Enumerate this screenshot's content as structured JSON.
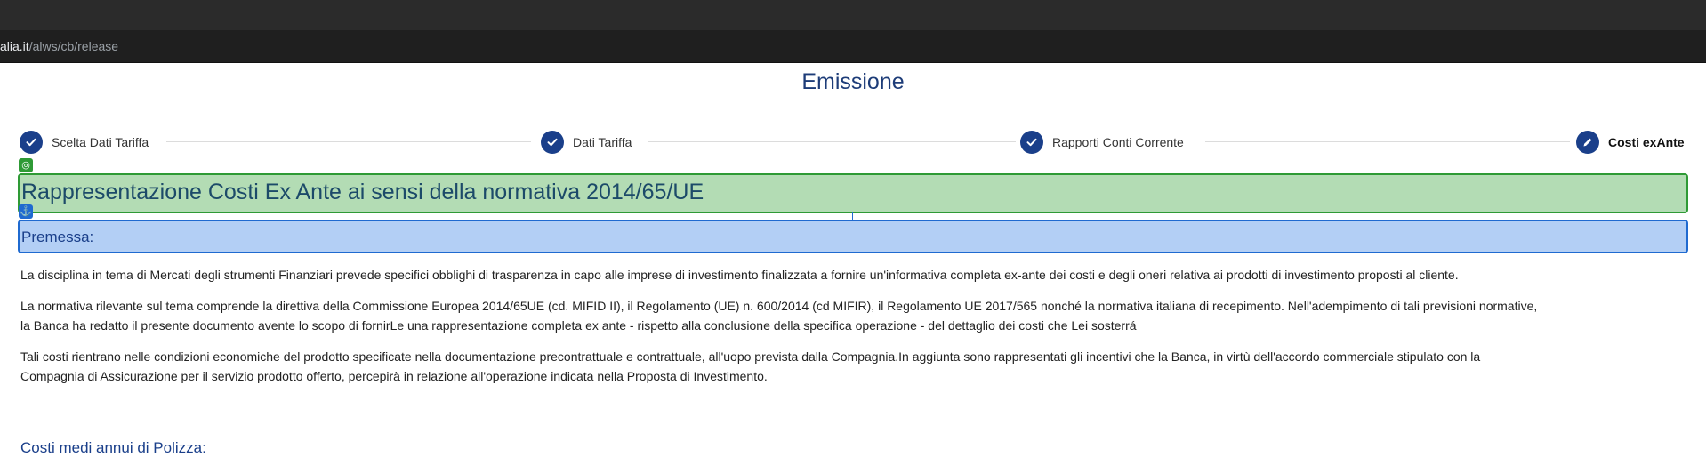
{
  "browser": {
    "url_host": "alia.it",
    "url_path": "/alws/cb/release"
  },
  "page": {
    "title": "Emissione"
  },
  "stepper": {
    "steps": [
      {
        "label": "Scelta Dati Tariffa",
        "state": "completed",
        "icon": "check-icon"
      },
      {
        "label": "Dati Tariffa",
        "state": "completed",
        "icon": "check-icon"
      },
      {
        "label": "Rapporti Conti Corrente",
        "state": "completed",
        "icon": "check-icon"
      },
      {
        "label": "Costi exAnte",
        "state": "active",
        "icon": "pencil-icon"
      }
    ]
  },
  "sections": {
    "main_title": "Rappresentazione Costi Ex Ante ai sensi della normativa 2014/65/UE",
    "premessa_title": "Premessa:"
  },
  "paragraphs": {
    "p1": "La disciplina in tema di Mercati degli strumenti Finanziari prevede specifici obblighi di trasparenza in capo alle imprese di investimento finalizzata a fornire un'informativa completa ex-ante dei costi e degli oneri relativa ai prodotti di investimento proposti al cliente.",
    "p2_line1": "La normativa rilevante sul tema comprende la direttiva della Commissione Europea 2014/65UE (cd. MIFID II), il Regolamento (UE) n. 600/2014 (cd MIFIR), il Regolamento UE 2017/565 nonché la normativa italiana di recepimento. Nell'adempimento di tali previsioni normative,",
    "p2_line2": "la Banca ha redatto il presente documento avente lo scopo di fornirLe una rappresentazione completa ex ante - rispetto alla conclusione della specifica operazione - del dettaglio dei costi che Lei sosterrá",
    "p3_line1": "Tali costi rientrano nelle condizioni economiche del prodotto specificate nella documentazione precontrattuale e contrattuale, all'uopo prevista dalla Compagnia.In aggiunta sono rappresentati gli incentivi che la Banca, in virtù dell'accordo commerciale stipulato con la",
    "p3_line2": "Compagnia di Assicurazione per il servizio prodotto offerto, percepirà in relazione all'operazione indicata nella Proposta di Investimento."
  },
  "footer": {
    "heading": "Costi medi annui di Polizza:"
  },
  "colors": {
    "accent": "#1a3f8a",
    "green_section": "#b3dcb4",
    "blue_section": "#b3cff5"
  }
}
